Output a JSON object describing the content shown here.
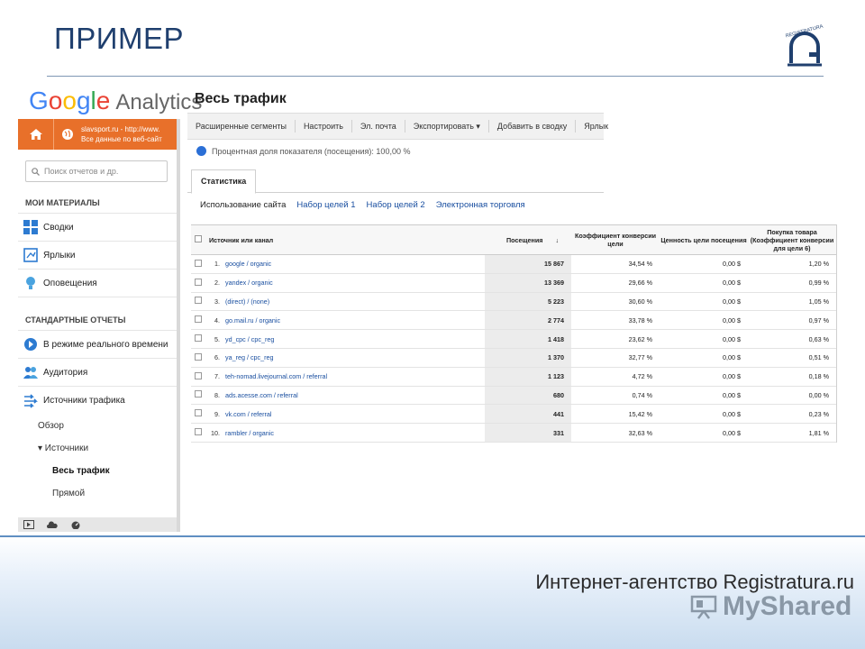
{
  "slide": {
    "title": "ПРИМЕР",
    "footer_text": "Интернет-агентство Registratura.ru",
    "watermark": "MyShared",
    "logo_text": "REGISTRATURA"
  },
  "ga": {
    "brand": [
      "G",
      "o",
      "o",
      "g",
      "l",
      "e"
    ],
    "product": "Analytics",
    "site_line1": "slavsport.ru - http://www.",
    "site_line2": "Все данные по веб-сайт",
    "search_placeholder": "Поиск отчетов и др.",
    "my_materials_label": "МОИ МАТЕРИАЛЫ",
    "nav_top": [
      "Сводки",
      "Ярлыки",
      "Оповещения"
    ],
    "standard_label": "СТАНДАРТНЫЕ ОТЧЕТЫ",
    "nav_std": [
      "В режиме реального времени",
      "Аудитория",
      "Источники трафика"
    ],
    "sub_overview": "Обзор",
    "sub_sources": "▾ Источники",
    "sub_all_traffic": "Весь трафик",
    "sub_direct": "Прямой",
    "page_title": "Весь трафик",
    "toolbar": [
      "Расширенные сегменты",
      "Настроить",
      "Эл. почта",
      "Экспортировать ▾",
      "Добавить в сводку",
      "Ярлык"
    ],
    "metric_note": "Процентная доля показателя (посещения): 100,00  %",
    "tab_label": "Статистика",
    "subtabs": [
      "Использование сайта",
      "Набор целей 1",
      "Набор целей 2",
      "Электронная торговля"
    ],
    "columns": {
      "source": "Источник или канал",
      "visits": "Посещения",
      "sort": "↓",
      "conv": "Коэффициент конверсии цели",
      "value": "Ценность цели посещения",
      "purchase": "Покупка товара (Коэффициент конверсии для цели 6)"
    },
    "rows": [
      {
        "n": "1.",
        "source": "google / organic",
        "visits": "15 867",
        "conv": "34,54  %",
        "value": "0,00 $",
        "purchase": "1,20 %"
      },
      {
        "n": "2.",
        "source": "yandex / organic",
        "visits": "13 369",
        "conv": "29,66  %",
        "value": "0,00 $",
        "purchase": "0,99 %"
      },
      {
        "n": "3.",
        "source": "(direct) / (none)",
        "visits": "5 223",
        "conv": "30,60  %",
        "value": "0,00 $",
        "purchase": "1,05 %"
      },
      {
        "n": "4.",
        "source": "go.mail.ru / organic",
        "visits": "2 774",
        "conv": "33,78  %",
        "value": "0,00 $",
        "purchase": "0,97 %"
      },
      {
        "n": "5.",
        "source": "yd_cpc / cpc_reg",
        "visits": "1 418",
        "conv": "23,62  %",
        "value": "0,00 $",
        "purchase": "0,63 %"
      },
      {
        "n": "6.",
        "source": "ya_reg / cpc_reg",
        "visits": "1 370",
        "conv": "32,77  %",
        "value": "0,00 $",
        "purchase": "0,51 %"
      },
      {
        "n": "7.",
        "source": "teh-nomad.livejournal.com / referral",
        "visits": "1 123",
        "conv": "4,72  %",
        "value": "0,00 $",
        "purchase": "0,18 %"
      },
      {
        "n": "8.",
        "source": "ads.acesse.com / referral",
        "visits": "680",
        "conv": "0,74  %",
        "value": "0,00 $",
        "purchase": "0,00 %"
      },
      {
        "n": "9.",
        "source": "vk.com / referral",
        "visits": "441",
        "conv": "15,42  %",
        "value": "0,00 $",
        "purchase": "0,23 %"
      },
      {
        "n": "10.",
        "source": "rambler / organic",
        "visits": "331",
        "conv": "32,63  %",
        "value": "0,00 $",
        "purchase": "1,81 %"
      }
    ]
  },
  "colors": {
    "accent_orange": "#e8702a",
    "link_blue": "#1a4fa0",
    "title_navy": "#1f3f6e"
  }
}
